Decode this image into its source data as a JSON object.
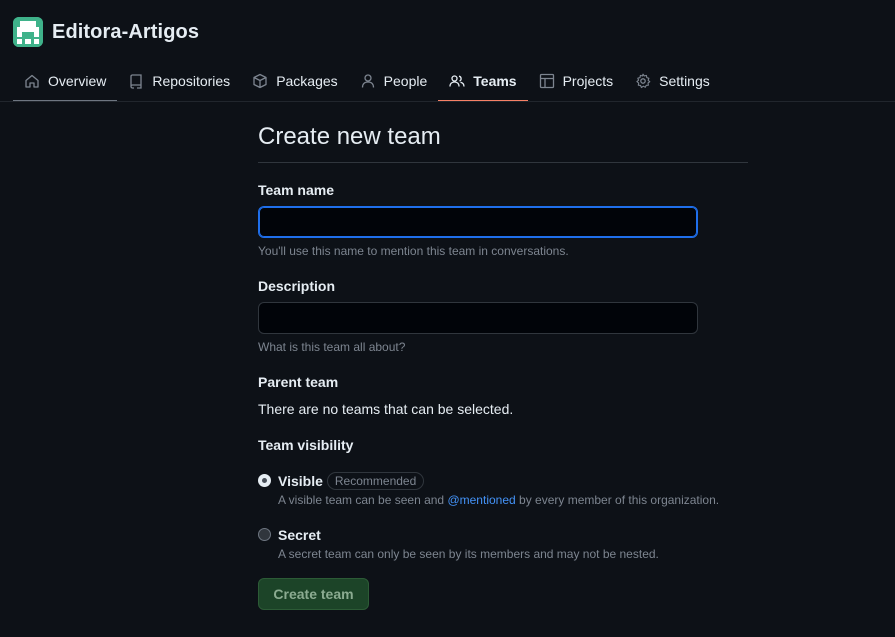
{
  "org": {
    "name": "Editora-Artigos"
  },
  "nav": {
    "overview": "Overview",
    "repositories": "Repositories",
    "packages": "Packages",
    "people": "People",
    "teams": "Teams",
    "projects": "Projects",
    "settings": "Settings"
  },
  "form": {
    "title": "Create new team",
    "team_name_label": "Team name",
    "team_name_value": "",
    "team_name_hint": "You'll use this name to mention this team in conversations.",
    "description_label": "Description",
    "description_value": "",
    "description_hint": "What is this team all about?",
    "parent_label": "Parent team",
    "parent_text": "There are no teams that can be selected.",
    "visibility_label": "Team visibility",
    "visible_title": "Visible",
    "visible_badge": "Recommended",
    "visible_desc_before": "A visible team can be seen and ",
    "visible_desc_link": "@mentioned",
    "visible_desc_after": " by every member of this organization.",
    "secret_title": "Secret",
    "secret_desc": "A secret team can only be seen by its members and may not be nested.",
    "submit_label": "Create team"
  },
  "colors": {
    "background": "#0d1117",
    "accent_underline": "#f78166",
    "link": "#4493f8",
    "button_bg": "#1c4428"
  }
}
